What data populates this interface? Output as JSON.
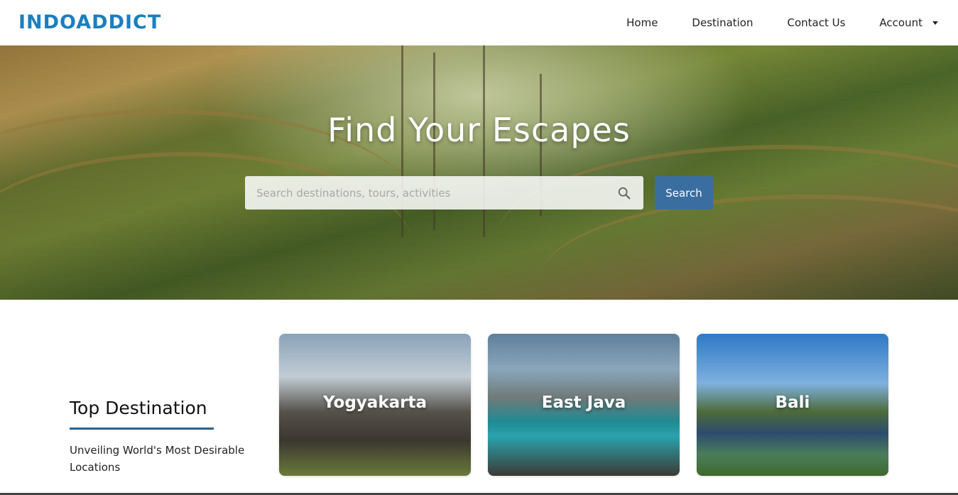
{
  "brand": {
    "logo_text": "INDOADDICT",
    "color": "#1a7fbf"
  },
  "nav": {
    "items": [
      {
        "label": "Home"
      },
      {
        "label": "Destination"
      },
      {
        "label": "Contact Us"
      },
      {
        "label": "Account"
      }
    ]
  },
  "hero": {
    "title": "Find Your Escapes",
    "search_placeholder": "Search destinations, tours, activities",
    "search_button": "Search",
    "button_color": "#3b6ea0"
  },
  "top_destination": {
    "title": "Top Destination",
    "subtitle": "Unveiling World's Most Desirable Locations",
    "cards": [
      {
        "label": "Yogyakarta"
      },
      {
        "label": "East Java"
      },
      {
        "label": "Bali"
      }
    ]
  }
}
